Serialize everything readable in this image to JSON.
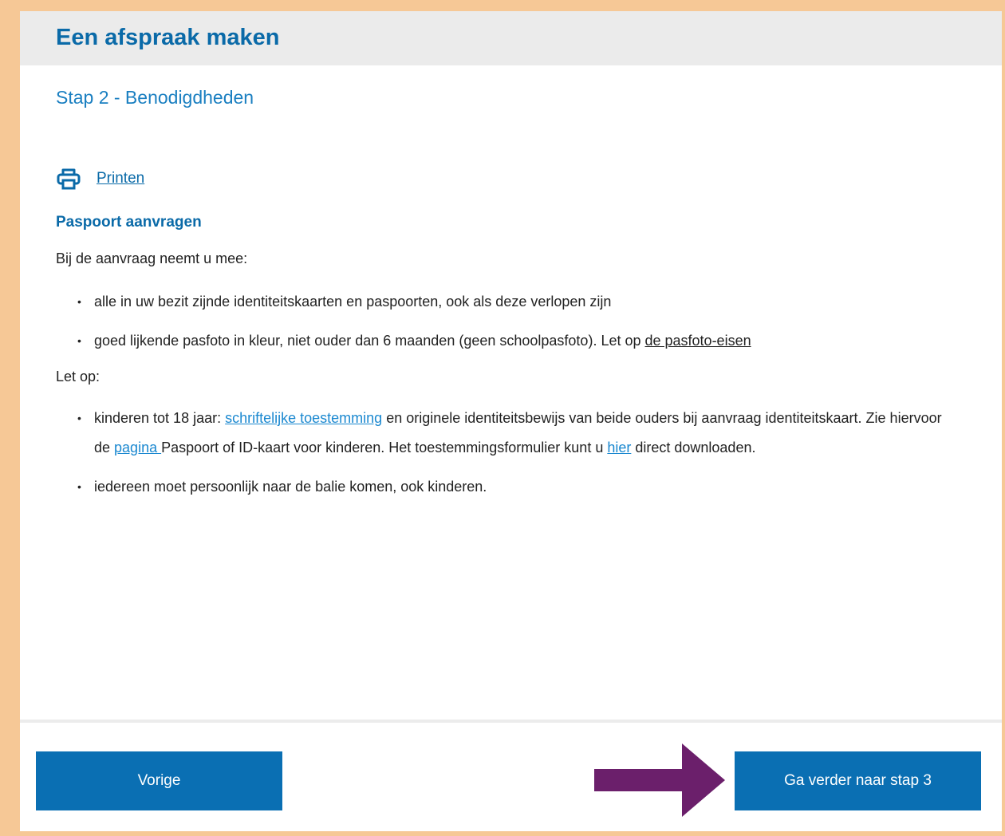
{
  "header": {
    "title": "Een afspraak maken"
  },
  "step": {
    "title": "Stap 2 - Benodigdheden"
  },
  "print": {
    "label": "Printen",
    "icon": "printer-icon"
  },
  "section": {
    "heading": "Paspoort aanvragen",
    "intro": "Bij de aanvraag neemt u mee:",
    "items": [
      {
        "text": "alle in uw bezit zijnde identiteitskaarten en paspoorten, ook als deze verlopen zijn"
      },
      {
        "text": "goed lijkende pasfoto in kleur, niet ouder dan 6 maanden (geen schoolpasfoto). Let op ",
        "link": "de pasfoto-eisen"
      }
    ],
    "note_label": "Let op:",
    "notes": [
      {
        "prefix": "kinderen tot 18 jaar: ",
        "link1": "schriftelijke toestemming",
        "mid1": " en originele identiteitsbewijs van beide ouders bij aanvraag identiteitskaart. Zie hiervoor de ",
        "link2": "pagina ",
        "mid2": "Paspoort of ID-kaart voor kinderen. Het toestemmingsformulier kunt u ",
        "link3": "hier",
        "suffix": " direct downloaden."
      },
      {
        "text": "iedereen moet persoonlijk naar de balie komen, ook kinderen."
      }
    ]
  },
  "footer": {
    "prev_label": "Vorige",
    "next_label": "Ga verder naar stap 3"
  },
  "colors": {
    "border": "#f6c896",
    "brand_blue": "#0a6aa8",
    "button": "#0a6fb3",
    "arrow": "#6b1f6b"
  }
}
